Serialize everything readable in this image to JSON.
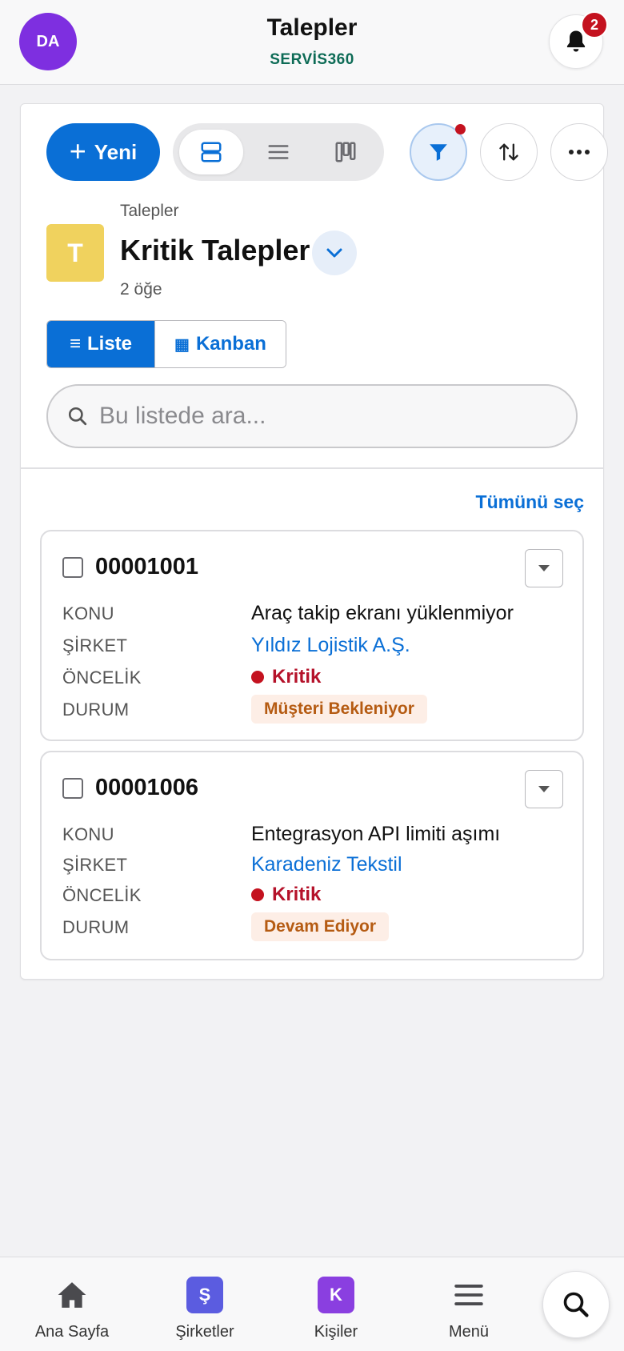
{
  "header": {
    "avatar_initials": "DA",
    "title": "Talepler",
    "subtitle": "SERVİS360",
    "notification_count": "2"
  },
  "toolbar": {
    "new_label": "Yeni",
    "new_icon": "plus-icon",
    "view_modes": [
      "card-view-icon",
      "list-view-icon",
      "kanban-view-icon"
    ],
    "active_view_mode": "card-view-icon",
    "filter_active": true
  },
  "list_header": {
    "breadcrumb": "Talepler",
    "icon_letter": "T",
    "icon_color": "#f0d25e",
    "title": "Kritik Talepler",
    "count": "2 öğe"
  },
  "view_toggle": {
    "list_label": "Liste",
    "list_icon": "≡",
    "kanban_label": "Kanban",
    "kanban_icon": "▦",
    "active": "list"
  },
  "search": {
    "placeholder": "Bu listede ara...",
    "value": ""
  },
  "select_all_label": "Tümünü seç",
  "field_labels": {
    "subject": "KONU",
    "company": "ŞİRKET",
    "priority": "ÖNCELİK",
    "status": "DURUM"
  },
  "cases": [
    {
      "number": "00001001",
      "subject": "Araç takip ekranı yüklenmiyor",
      "company": "Yıldız Lojistik A.Ş.",
      "priority": "Kritik",
      "status": "Müşteri Bekleniyor"
    },
    {
      "number": "00001006",
      "subject": "Entegrasyon API limiti aşımı",
      "company": "Karadeniz Tekstil",
      "priority": "Kritik",
      "status": "Devam Ediyor"
    }
  ],
  "bottom_nav": {
    "home": {
      "label": "Ana Sayfa",
      "icon": "home-icon"
    },
    "companies": {
      "label": "Şirketler",
      "tile_letter": "Ş",
      "color": "#5b5ce0"
    },
    "contacts": {
      "label": "Kişiler",
      "tile_letter": "K",
      "color": "#8a3fe0"
    },
    "menu": {
      "label": "Menü",
      "icon": "hamburger-icon"
    },
    "search_icon": "search-icon"
  },
  "colors": {
    "brand_blue": "#0a6fd6",
    "critical_red": "#c4121f",
    "status_orange": "#b55b12"
  }
}
